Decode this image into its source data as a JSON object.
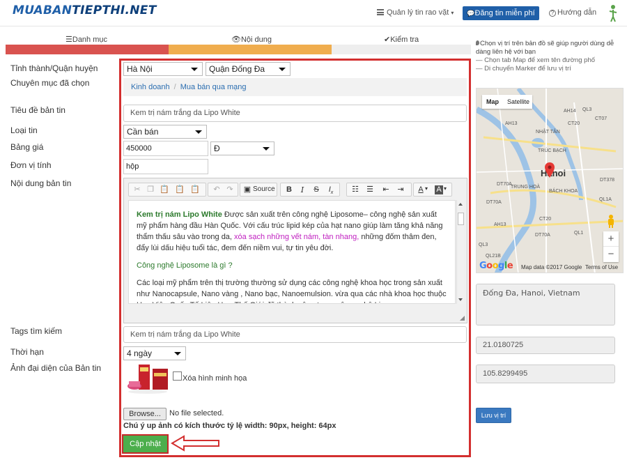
{
  "header": {
    "logo_part1": "MUABAN",
    "logo_part2": "TIEPTHI.NET",
    "manage_label": "Quản lý tin rao vặt",
    "post_label": "Đăng tin miễn phí",
    "help_label": "Hướng dẫn"
  },
  "steps": [
    {
      "label": "Danh mục",
      "color": "#d9534f"
    },
    {
      "label": "Nội dung",
      "color": "#f0ad4e"
    },
    {
      "label": "Kiểm tra",
      "color": "#eeeeee"
    }
  ],
  "form": {
    "labels": {
      "location": "Tỉnh thành/Quận huyện",
      "category": "Chuyên mục đã chọn",
      "title": "Tiêu đề bản tin",
      "type": "Loại tin",
      "price": "Bảng giá",
      "unit": "Đơn vị tính",
      "content": "Nội dung bản tin",
      "tags": "Tags tìm kiếm",
      "duration": "Thời hạn",
      "image": "Ảnh đại diện của Bản tin"
    },
    "province": "Hà Nội",
    "district": "Quận Đống Đa",
    "breadcrumb": [
      "Kinh doanh",
      "Mua bán qua mạng"
    ],
    "title_value": "Kem trị nám trắng da Lipo White",
    "type_value": "Cần bán",
    "price_value": "450000",
    "currency": "Đ",
    "unit_value": "hộp",
    "tags_value": "Kem trị nám trắng da Lipo White",
    "duration_value": "4 ngày",
    "remove_image_label": "Xóa hình minh họa",
    "browse_label": "Browse...",
    "no_file": "No file selected.",
    "note": "Chú ý up ảnh có kích thước tỷ lệ width: 90px, height: 64px",
    "update_label": "Cập nhật"
  },
  "editor": {
    "source_label": "Source",
    "p1_bold": "Kem trị nám Lipo White",
    "p1_a": " Được sản xuất trên công nghệ Liposome– công nghệ sản xuất mỹ phẩm hàng đầu Hàn Quốc. Với cấu trúc lipid kép của hạt nano giúp làm tăng khả năng thẩm thấu sâu vào trong da, ",
    "p1_link": "xóa sạch những vết nám, tàn nhang,",
    "p1_b": " những đốm thâm đen, đẩy lùi dấu hiệu tuổi tác, đem đến niềm vui, tự tin yêu đời.",
    "p2": "Công nghệ Liposome là gì ?",
    "p3": "Các loại mỹ phẩm trên thị trường thường sử dụng các công nghệ khoa học trong sản xuất như Nanocapsule, Nano vàng , Nano bạc, Nanoemulsion. vừa qua các nhà khoa học thuộc Học Viện Quốc Tế Liên Hợp Thế Giới đã thành công trong công nghệ Liposome."
  },
  "sidebar": {
    "tip_main": "Chọn vị trí trên bản đồ sẽ giúp người dùng dễ dàng liên hệ với bạn",
    "tip_sub1": "— Chọn tab Map để xem tên đường phố",
    "tip_sub2": "— Di chuyển Marker để lưu vị trí",
    "map_tab": "Map",
    "satellite_tab": "Satellite",
    "city": "Hanoi",
    "map_data": "Map data ©2017 Google",
    "terms": "Terms of Use",
    "address": "Đống Đa, Hanoi, Vietnam",
    "lat": "21.0180725",
    "lng": "105.8299495",
    "save_label": "Lưu vị trí",
    "map_labels": {
      "ah14": "AH14",
      "ql3": "QL3",
      "ct07": "CT07",
      "ah13": "AH13",
      "ct20": "CT20",
      "nhattan": "NHẬT TÂN",
      "truchbach": "TRÚC BẠCH",
      "dt378": "DT378",
      "dt70a": "DT70A",
      "trunghoa": "TRUNG HOÀ",
      "bachkhoa": "BÁCH KHOA",
      "ql1a": "QL1A",
      "ah13b": "AH13",
      "dt70b": "DT70A",
      "ql21b": "QL21B",
      "dt70c": "DT70A",
      "ql3b": "QL3",
      "ql1b": "QL1",
      "ct20b": "CT20"
    }
  }
}
